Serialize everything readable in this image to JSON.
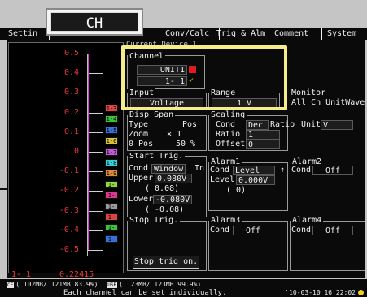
{
  "header": {
    "ch_label": "CH"
  },
  "tabs": [
    {
      "label": "Settin"
    },
    {
      "label": "Conv/Calc"
    },
    {
      "label": "Trig & Alm"
    },
    {
      "label": "Comment"
    },
    {
      "label": "System"
    }
  ],
  "subtitle": "Current  Device 1",
  "wave": {
    "y_labels": [
      "0.5",
      "0.4",
      "0.3",
      "0.2",
      "0.1",
      "0",
      "-0.1",
      "-0.2",
      "-0.3",
      "-0.4",
      "-0.5"
    ],
    "markers": [
      {
        "label": "1-3",
        "color": "#d84545"
      },
      {
        "label": "1-4",
        "color": "#3fbf3f"
      },
      {
        "label": "1-5",
        "color": "#3a6fd8"
      },
      {
        "label": "1-6",
        "color": "#d8c23a"
      },
      {
        "label": "1-7",
        "color": "#c05ad8"
      },
      {
        "label": "1-8",
        "color": "#3acfd8"
      },
      {
        "label": "1-9",
        "color": "#d88b3a"
      },
      {
        "label": "1-10",
        "color": "#8ad83a"
      },
      {
        "label": "1-11",
        "color": "#d83a8b"
      },
      {
        "label": "1-12",
        "color": "#9a9a9a"
      },
      {
        "label": "1-13",
        "color": "#d84545"
      },
      {
        "label": "1-14",
        "color": "#3fbf3f"
      },
      {
        "label": "1-15",
        "color": "#3a6fd8"
      }
    ],
    "footer_ch": "1- 1",
    "footer_value": "0.22415"
  },
  "channel": {
    "title": "Channel",
    "unit": "UNIT1",
    "ch": "1- 1",
    "check": "✓"
  },
  "input": {
    "title": "Input",
    "value": "Voltage"
  },
  "range": {
    "title": "Range",
    "value": "1 V"
  },
  "monitor": {
    "title": "Monitor",
    "value": "All Ch UnitWave"
  },
  "disp_span": {
    "title": "Disp Span",
    "type_label": "Type",
    "type_value": "Pos",
    "zoom_label": "Zoom",
    "zoom_value": "×  1",
    "pos_label": "0 Pos",
    "pos_value": "50 %"
  },
  "scaling": {
    "title": "Scaling",
    "cond_label": "Cond",
    "cond_dec": "Dec",
    "cond_ratio": "Ratio",
    "unit_label": "Unit",
    "unit_value": "V",
    "ratio_label": "Ratio",
    "ratio_value": "1",
    "offset_label": "Offset",
    "offset_value": "0"
  },
  "start_trig": {
    "title": "Start Trig.",
    "cond_label": "Cond",
    "cond_value": "Window",
    "in_label": "In",
    "upper_label": "Upper",
    "upper_value": "0.080V",
    "upper_paren": "(        0.08)",
    "lower_label": "Lower",
    "lower_value": "-0.080V",
    "lower_paren": "(       -0.08)"
  },
  "alarm1": {
    "title": "Alarm1",
    "cond_label": "Cond",
    "cond_value": "Level",
    "arrow": "↑",
    "level_label": "Level",
    "level_value": "0.000V",
    "paren": "(          0)"
  },
  "alarm2": {
    "title": "Alarm2",
    "cond_label": "Cond",
    "cond_value": "Off"
  },
  "stop_trig": {
    "title": "Stop Trig.",
    "button": "Stop trig on."
  },
  "alarm3": {
    "title": "Alarm3",
    "cond_label": "Cond",
    "cond_value": "Off"
  },
  "alarm4": {
    "title": "Alarm4",
    "cond_label": "Cond",
    "cond_value": "Off"
  },
  "status": {
    "storage1_icon": "CF",
    "storage1": "( 102MB/ 121MB 83.9%)",
    "storage2_icon": "USB",
    "storage2": "( 123MB/ 123MB 99.9%)",
    "message": "Each channel can be set individually.",
    "datetime": "'10-03-10 16:22:02"
  }
}
